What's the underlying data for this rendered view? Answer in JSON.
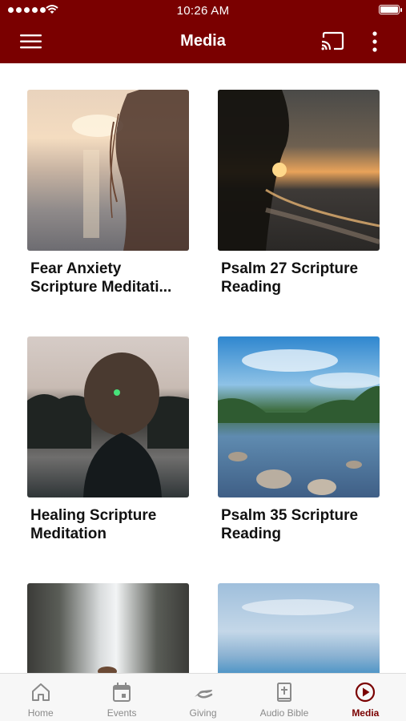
{
  "status_bar": {
    "time": "10:26 AM"
  },
  "header": {
    "title": "Media"
  },
  "media_items": [
    {
      "title": "Fear Anxiety Scripture Meditati..."
    },
    {
      "title": "Psalm 27 Scripture Reading"
    },
    {
      "title": "Healing Scripture Meditation"
    },
    {
      "title": "Psalm 35 Scripture Reading"
    },
    {
      "title": ""
    },
    {
      "title": ""
    }
  ],
  "tabs": [
    {
      "label": "Home",
      "icon": "home-icon"
    },
    {
      "label": "Events",
      "icon": "calendar-icon"
    },
    {
      "label": "Giving",
      "icon": "giving-hand-icon"
    },
    {
      "label": "Audio Bible",
      "icon": "bible-icon"
    },
    {
      "label": "Media",
      "icon": "play-circle-icon",
      "active": true
    }
  ],
  "colors": {
    "header_bg": "#7a0000",
    "accent": "#7a0000",
    "tab_inactive": "#8a8a8a"
  }
}
